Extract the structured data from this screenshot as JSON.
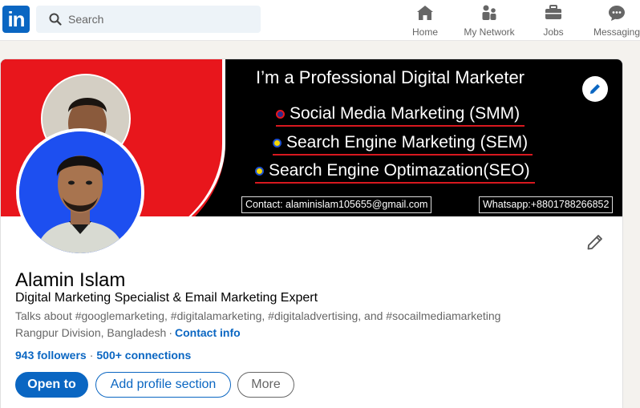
{
  "nav": {
    "logo_text": "in",
    "search_placeholder": "Search",
    "items": [
      {
        "label": "Home",
        "icon": "home-icon"
      },
      {
        "label": "My Network",
        "icon": "network-icon"
      },
      {
        "label": "Jobs",
        "icon": "jobs-icon"
      },
      {
        "label": "Messaging",
        "icon": "messaging-icon"
      }
    ]
  },
  "banner": {
    "title": "I’m a Professional Digital Marketer",
    "services": [
      "Social Media Marketing (SMM)",
      "Search Engine  Marketing (SEM)",
      "Search Engine  Optimazation(SEO)"
    ],
    "contact": "Contact: alaminislam105655@gmail.com",
    "whatsapp": "Whatsapp:+8801788266852",
    "colors": {
      "red": "#e8161c",
      "dark": "#000000"
    }
  },
  "profile": {
    "name": "Alamin Islam",
    "headline": "Digital Marketing Specialist & Email Marketing Expert",
    "talks_about": "Talks about #googlemarketing, #digitalamarketing, #digitaladvertising, and #socailmediamarketing",
    "location": "Rangpur Division, Bangladesh",
    "contact_info": "Contact info",
    "followers": "943 followers",
    "connections": "500+ connections"
  },
  "actions": {
    "open_to": "Open to",
    "add_section": "Add profile section",
    "more": "More"
  },
  "accent": "#0a66c2"
}
